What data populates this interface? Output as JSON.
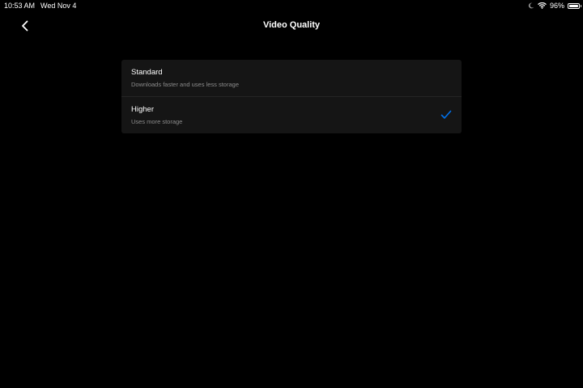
{
  "status_bar": {
    "time": "10:53 AM",
    "date": "Wed Nov 4",
    "battery_percent": "96%",
    "battery_level": 0.96,
    "icons": [
      "do-not-disturb-icon",
      "wifi-icon",
      "battery-icon"
    ]
  },
  "header": {
    "title": "Video Quality",
    "back_icon": "chevron-left-icon"
  },
  "options": [
    {
      "title": "Standard",
      "subtitle": "Downloads faster and uses less storage",
      "selected": false
    },
    {
      "title": "Higher",
      "subtitle": "Uses more storage",
      "selected": true
    }
  ],
  "colors": {
    "background": "#000000",
    "card": "#151515",
    "accent": "#0071eb",
    "subtitle": "#8c8c8c"
  }
}
